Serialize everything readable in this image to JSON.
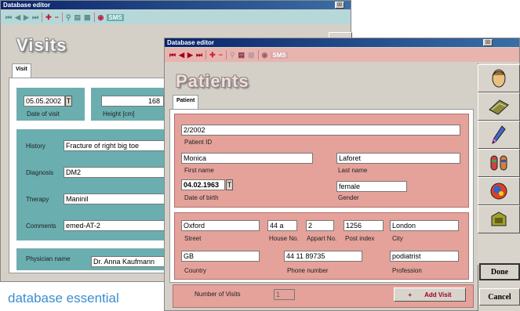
{
  "visits_window": {
    "titlebar": "Database editor",
    "close_glyph": "☒",
    "title": "Visits",
    "tab": "Visit",
    "date_value": "05.05.2002",
    "date_btn": "T",
    "date_label": "Date of visit",
    "height_value": "168",
    "height_label": "Height [cm]",
    "history_label": "History",
    "history_value": "Fracture of right big toe",
    "diagnosis_label": "Diagnosis",
    "diagnosis_value": "DM2",
    "therapy_label": "Therapy",
    "therapy_value": "Maninil",
    "comments_label": "Comments",
    "comments_value": "emed-AT-2",
    "physician_label": "Physician name",
    "physician_value": "Dr. Anna Kaufmann",
    "sms": "SMS"
  },
  "caption": "database essential",
  "patients_window": {
    "titlebar": "Database editor",
    "close_glyph": "☒",
    "title": "Patients",
    "tab": "Patient",
    "sms": "SMS",
    "patient_id_value": "2/2002",
    "patient_id_label": "Patient ID",
    "first_name_value": "Monica",
    "first_name_label": "First name",
    "last_name_value": "Laforet",
    "last_name_label": "Last name",
    "dob_value": "04.02.1963",
    "dob_btn": "T",
    "dob_label": "Date of birth",
    "gender_value": "female",
    "gender_label": "Gender",
    "street_value": "Oxford",
    "street_label": "Street",
    "house_value": "44 a",
    "house_label": "House No.",
    "appart_value": "2",
    "appart_label": "Appart No.",
    "post_value": "1256",
    "post_label": "Post index",
    "city_value": "London",
    "city_label": "City",
    "country_value": "GB",
    "country_label": "Country",
    "phone_value": "44 11 89735",
    "phone_label": "Phone number",
    "profession_value": "podiatrist",
    "profession_label": "Profession",
    "visits_label": "Number of Visits",
    "visits_value": "1",
    "add_visit_plus": "+",
    "add_visit_label": "Add Visit",
    "done_label": "Done",
    "cancel_label": "Cancel"
  },
  "colors": {
    "teal": "#6aaeb0",
    "pink": "#e4a29a",
    "gray": "#d8d4cc",
    "accent": "#a00020"
  }
}
